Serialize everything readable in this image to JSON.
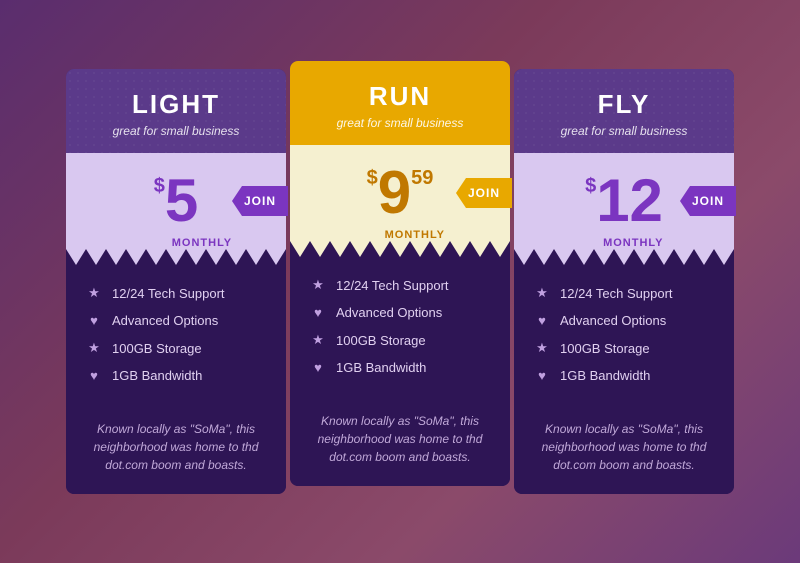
{
  "plans": [
    {
      "id": "light",
      "name": "LIGHT",
      "subtitle": "great for small business",
      "price_symbol": "$",
      "price_main": "5",
      "price_cents": "",
      "price_period": "MONTHLY",
      "join_label": "JOIN",
      "header_class": "light-header",
      "pricing_class": "light-pricing",
      "features": [
        {
          "icon": "★",
          "text": "12/24 Tech Support"
        },
        {
          "icon": "♥",
          "text": "Advanced Options"
        },
        {
          "icon": "★",
          "text": "100GB Storage"
        },
        {
          "icon": "♥",
          "text": "1GB Bandwidth"
        }
      ],
      "description": "Known locally as \"SoMa\", this neighborhood was home to thd dot.com boom and boasts."
    },
    {
      "id": "run",
      "name": "RUN",
      "subtitle": "great for small business",
      "price_symbol": "$",
      "price_main": "9",
      "price_cents": "59",
      "price_period": "MONTHLY",
      "join_label": "JOIN",
      "header_class": "run-header",
      "pricing_class": "run-pricing",
      "features": [
        {
          "icon": "★",
          "text": "12/24 Tech Support"
        },
        {
          "icon": "♥",
          "text": "Advanced Options"
        },
        {
          "icon": "★",
          "text": "100GB Storage"
        },
        {
          "icon": "♥",
          "text": "1GB Bandwidth"
        }
      ],
      "description": "Known locally as \"SoMa\", this neighborhood was home to thd dot.com boom and boasts."
    },
    {
      "id": "fly",
      "name": "FLY",
      "subtitle": "great for small business",
      "price_symbol": "$",
      "price_main": "12",
      "price_cents": "",
      "price_period": "MONTHLY",
      "join_label": "JOIN",
      "header_class": "fly-header",
      "pricing_class": "fly-pricing",
      "features": [
        {
          "icon": "★",
          "text": "12/24 Tech Support"
        },
        {
          "icon": "♥",
          "text": "Advanced Options"
        },
        {
          "icon": "★",
          "text": "100GB Storage"
        },
        {
          "icon": "♥",
          "text": "1GB Bandwidth"
        }
      ],
      "description": "Known locally as \"SoMa\", this neighborhood was home to thd dot.com boom and boasts."
    }
  ]
}
